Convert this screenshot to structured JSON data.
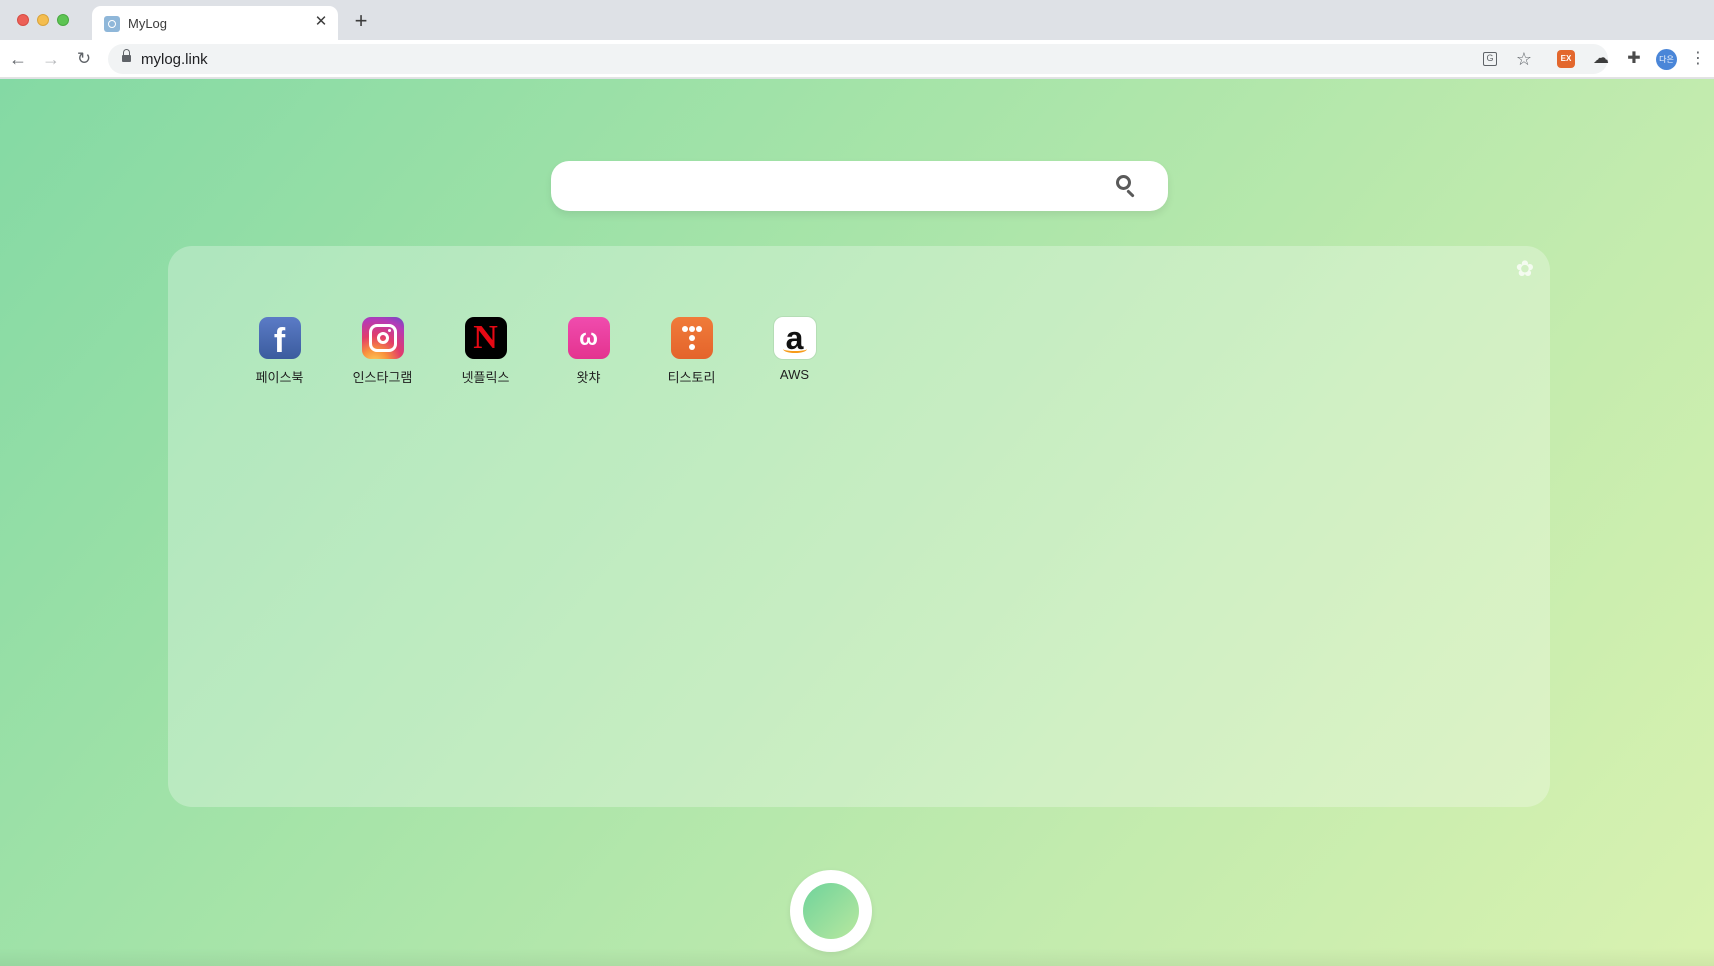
{
  "browser": {
    "tab": {
      "title": "MyLog",
      "close_glyph": "✕"
    },
    "new_tab_glyph": "+",
    "address": {
      "url": "mylog.link"
    },
    "nav": {
      "back_glyph": "←",
      "forward_glyph": "→",
      "reload_glyph": "↻"
    },
    "toolbar": {
      "extension_ex_label": "EX",
      "profile_avatar_label": "다은",
      "menu_glyph": "⋮",
      "star_glyph": "☆",
      "translate_glyph": "G"
    }
  },
  "search": {
    "placeholder": "",
    "value": ""
  },
  "panel": {
    "settings_icon": "gear-icon",
    "shortcuts": [
      {
        "label": "페이스북",
        "icon": "facebook-icon",
        "glyph": "f"
      },
      {
        "label": "인스타그램",
        "icon": "instagram-icon",
        "glyph": ""
      },
      {
        "label": "넷플릭스",
        "icon": "netflix-icon",
        "glyph": "N"
      },
      {
        "label": "왓챠",
        "icon": "watcha-icon",
        "glyph": "ω"
      },
      {
        "label": "티스토리",
        "icon": "tistory-icon",
        "glyph": ""
      },
      {
        "label": "AWS",
        "icon": "amazon-icon",
        "glyph": "a"
      }
    ]
  },
  "colors": {
    "background_start": "#84d9a4",
    "background_end": "#d9f2b0",
    "facebook": "#3b5c9e",
    "netflix": "#e50914",
    "watcha": "#e4338f",
    "tistory": "#e4642b",
    "amazon_smile": "#f79b1a"
  }
}
